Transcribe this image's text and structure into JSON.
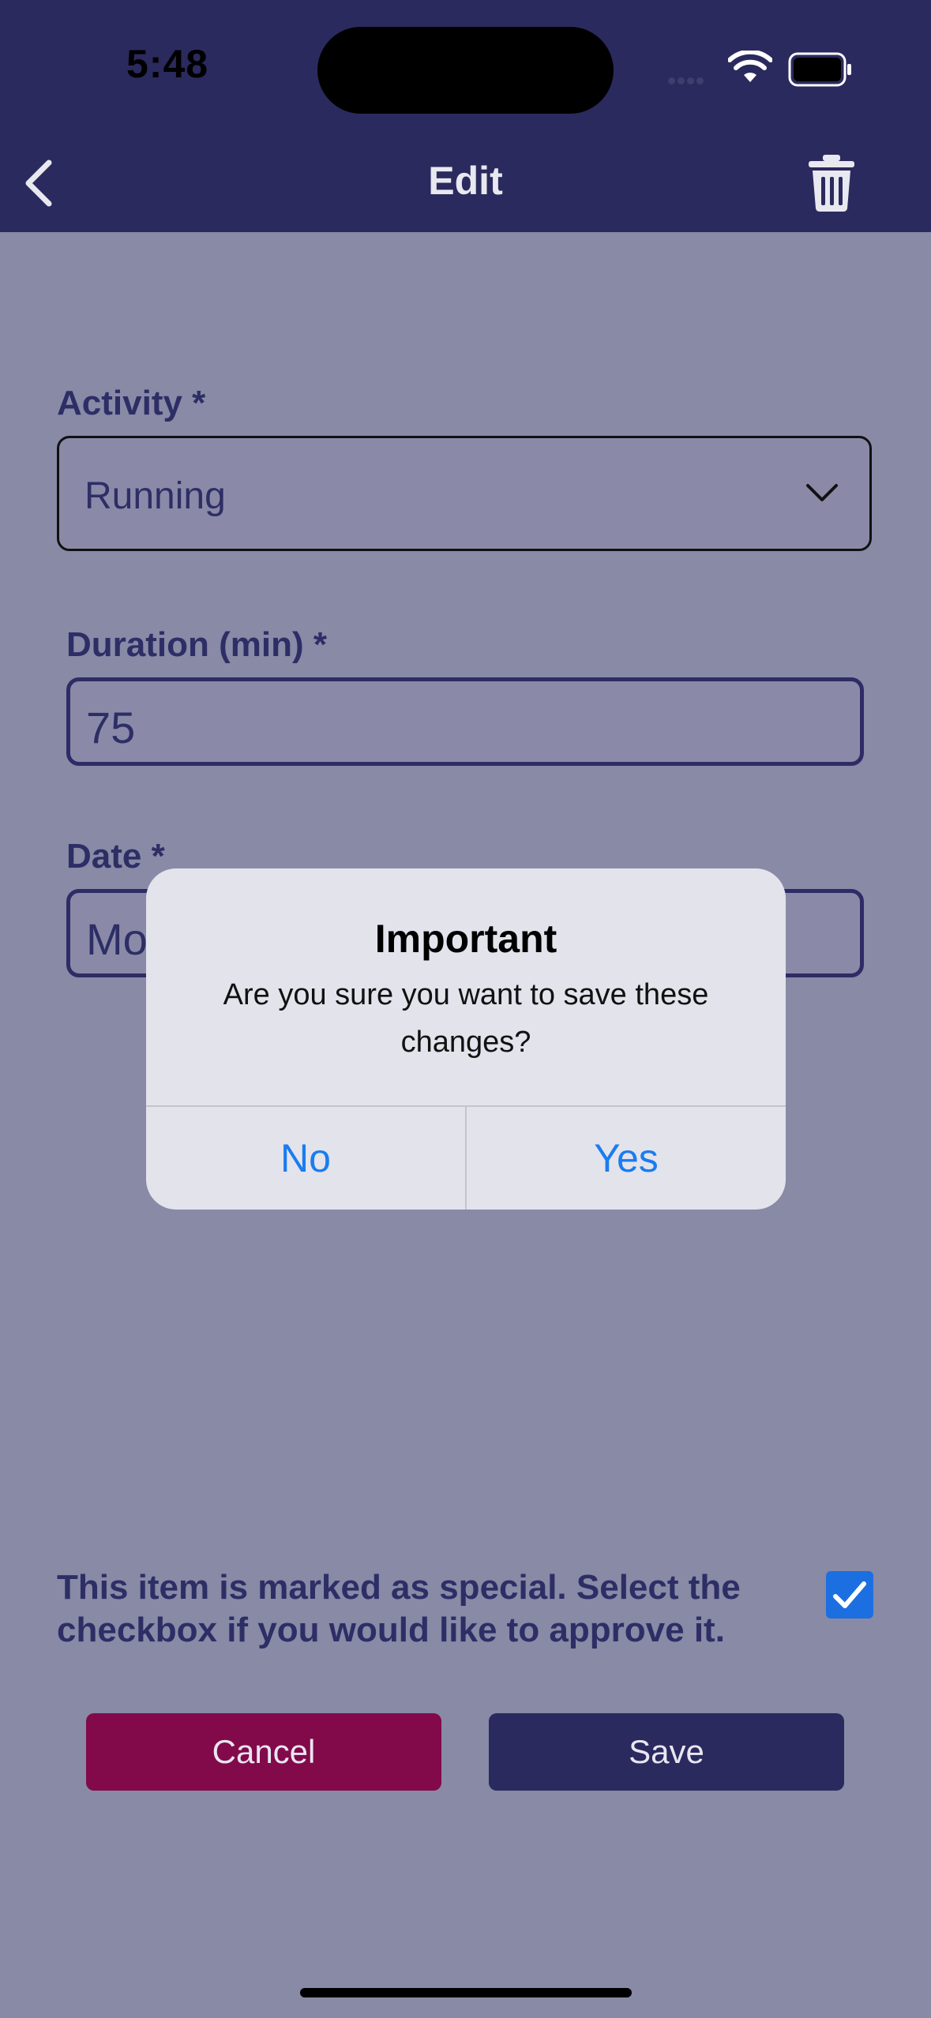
{
  "status_bar": {
    "time": "5:48"
  },
  "nav": {
    "title": "Edit"
  },
  "form": {
    "activity": {
      "label": "Activity *",
      "value": "Running"
    },
    "duration": {
      "label": "Duration (min) *",
      "value": "75"
    },
    "date": {
      "label": "Date *",
      "value": "Mo"
    }
  },
  "notice": {
    "text": "This item is marked as special. Select the checkbox if you would like to approve it.",
    "checked": true
  },
  "buttons": {
    "cancel": "Cancel",
    "save": "Save"
  },
  "alert": {
    "title": "Important",
    "message": "Are you sure you want to save these changes?",
    "no": "No",
    "yes": "Yes"
  },
  "colors": {
    "nav_background": "#2b2a5e",
    "dimmed_background": "#888aa6",
    "cancel": "#820a4a",
    "save": "#2b2a5e",
    "alert_button": "#1a7cf0",
    "checkbox": "#1b6fe0"
  },
  "icons": [
    "back-chevron-icon",
    "trash-icon",
    "chevron-down-icon",
    "wifi-icon",
    "battery-icon",
    "checkmark-icon"
  ]
}
